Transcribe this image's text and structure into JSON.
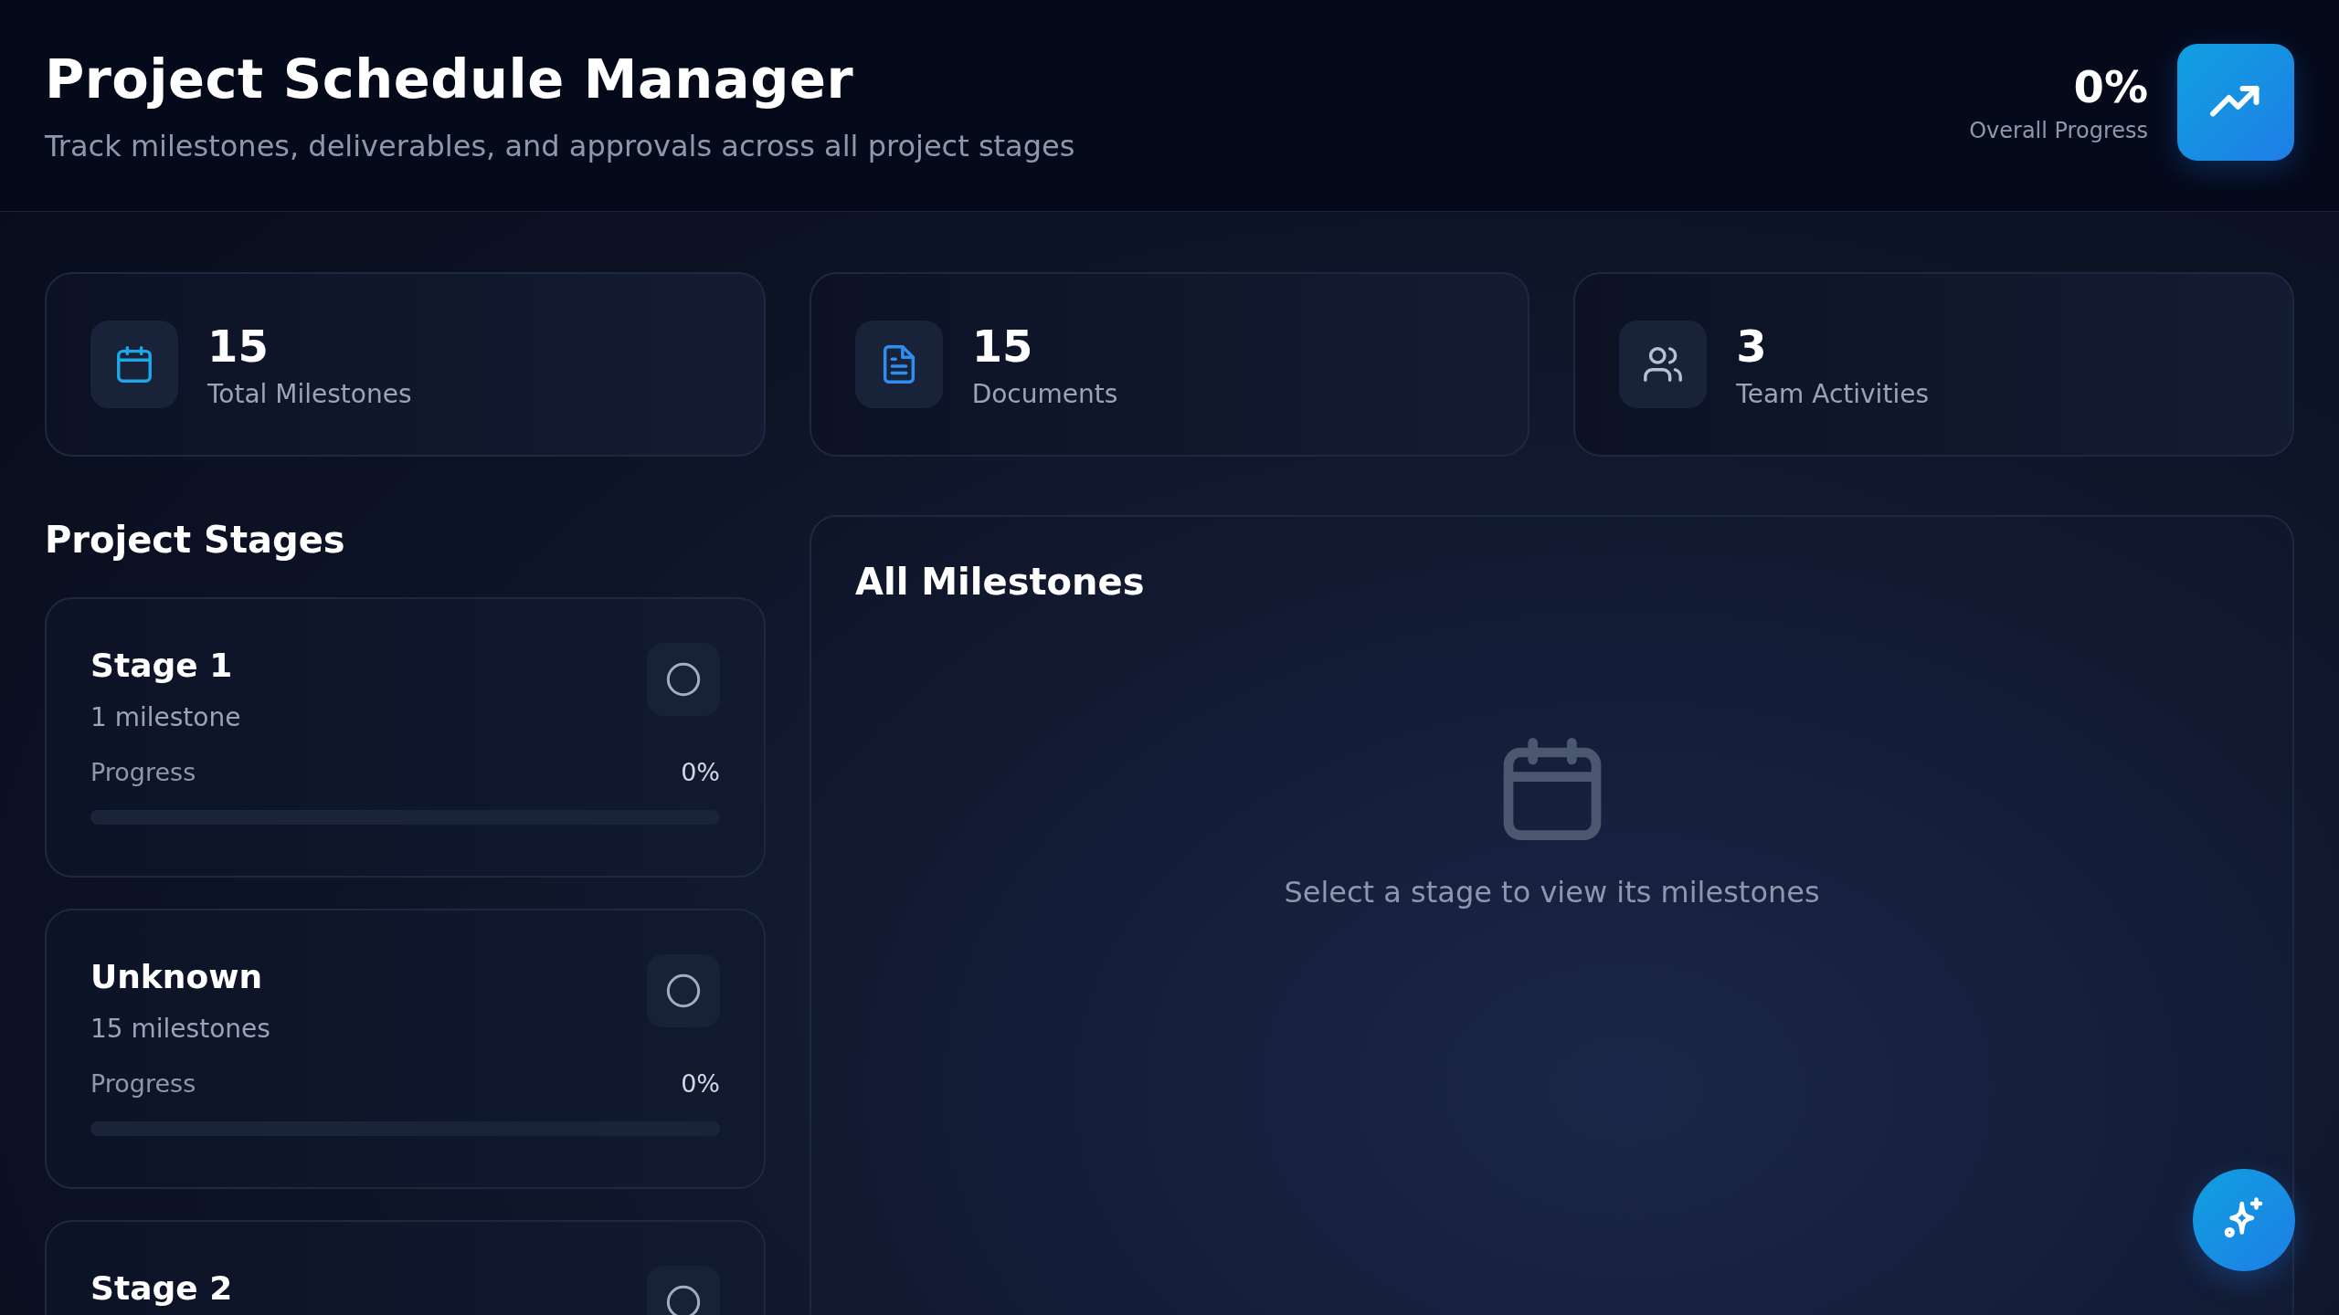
{
  "header": {
    "title": "Project Schedule Manager",
    "subtitle": "Track milestones, deliverables, and approvals across all project stages",
    "progress_value": "0%",
    "progress_label": "Overall Progress"
  },
  "stats": [
    {
      "kind": "calendar",
      "value": "15",
      "label": "Total Milestones"
    },
    {
      "kind": "document",
      "value": "15",
      "label": "Documents"
    },
    {
      "kind": "people",
      "value": "3",
      "label": "Team Activities"
    }
  ],
  "stages_heading": "Project Stages",
  "stages": [
    {
      "name": "Stage 1",
      "count": "1 milestone",
      "progress_label": "Progress",
      "progress_value": "0%",
      "level": 0
    },
    {
      "name": "Unknown",
      "count": "15 milestones",
      "progress_label": "Progress",
      "progress_value": "0%",
      "level": 0
    },
    {
      "name": "Stage 2"
    }
  ],
  "milestones_panel": {
    "title": "All Milestones",
    "empty_message": "Select a stage to view its milestones"
  }
}
